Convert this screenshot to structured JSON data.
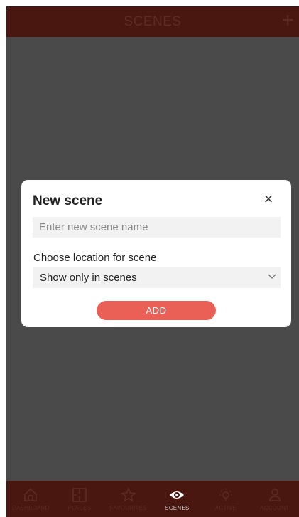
{
  "header": {
    "title": "SCENES",
    "add_icon": "+"
  },
  "dialog": {
    "title": "New scene",
    "close_icon": "×",
    "name_placeholder": "Enter new scene name",
    "name_value": "",
    "location_label": "Choose location for scene",
    "location_selected": "Show only in scenes",
    "add_label": "ADD"
  },
  "bottom_nav": {
    "items": [
      {
        "label": "DASHBOARD",
        "icon": "home-icon"
      },
      {
        "label": "PLACES",
        "icon": "floorplan-icon"
      },
      {
        "label": "FAVOURITES",
        "icon": "star-icon"
      },
      {
        "label": "SCENES",
        "icon": "eye-icon",
        "active": true
      },
      {
        "label": "ACTIVE",
        "icon": "bulb-icon"
      },
      {
        "label": "ACCOUNT",
        "icon": "person-icon"
      }
    ]
  },
  "colors": {
    "bar": "#4a1610",
    "bar_text_dim": "#5e2a22",
    "overlay": "#4a4a4a",
    "accent": "#ea5f56"
  }
}
